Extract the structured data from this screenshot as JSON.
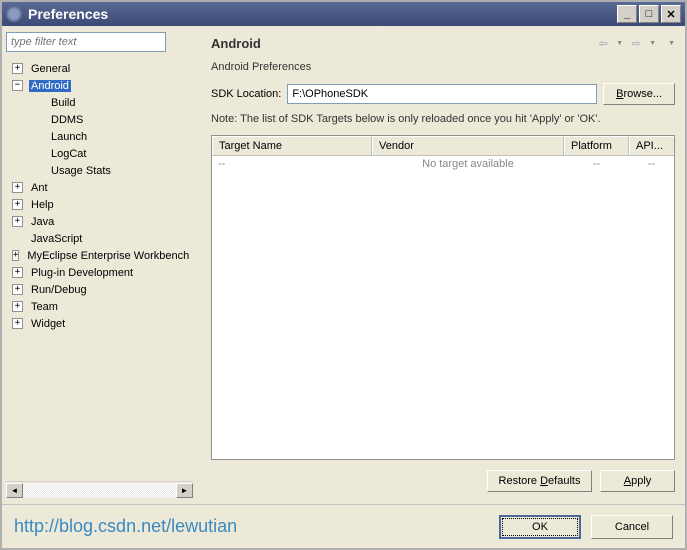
{
  "titlebar": {
    "title": "Preferences"
  },
  "filter": {
    "placeholder": "type filter text"
  },
  "tree": {
    "items": [
      {
        "label": "General",
        "expandable": true,
        "expanded": false,
        "indent": 0,
        "selected": false
      },
      {
        "label": "Android",
        "expandable": true,
        "expanded": true,
        "indent": 0,
        "selected": true
      },
      {
        "label": "Build",
        "expandable": false,
        "indent": 1,
        "selected": false
      },
      {
        "label": "DDMS",
        "expandable": false,
        "indent": 1,
        "selected": false
      },
      {
        "label": "Launch",
        "expandable": false,
        "indent": 1,
        "selected": false
      },
      {
        "label": "LogCat",
        "expandable": false,
        "indent": 1,
        "selected": false
      },
      {
        "label": "Usage Stats",
        "expandable": false,
        "indent": 1,
        "selected": false
      },
      {
        "label": "Ant",
        "expandable": true,
        "expanded": false,
        "indent": 0,
        "selected": false
      },
      {
        "label": "Help",
        "expandable": true,
        "expanded": false,
        "indent": 0,
        "selected": false
      },
      {
        "label": "Java",
        "expandable": true,
        "expanded": false,
        "indent": 0,
        "selected": false
      },
      {
        "label": "JavaScript",
        "expandable": false,
        "indent": 0,
        "selected": false
      },
      {
        "label": "MyEclipse Enterprise Workbench",
        "expandable": true,
        "expanded": false,
        "indent": 0,
        "selected": false
      },
      {
        "label": "Plug-in Development",
        "expandable": true,
        "expanded": false,
        "indent": 0,
        "selected": false
      },
      {
        "label": "Run/Debug",
        "expandable": true,
        "expanded": false,
        "indent": 0,
        "selected": false
      },
      {
        "label": "Team",
        "expandable": true,
        "expanded": false,
        "indent": 0,
        "selected": false
      },
      {
        "label": "Widget",
        "expandable": true,
        "expanded": false,
        "indent": 0,
        "selected": false
      }
    ]
  },
  "page": {
    "title": "Android",
    "section": "Android Preferences",
    "sdk_label": "SDK Location:",
    "sdk_value": "F:\\OPhoneSDK",
    "browse": "Browse...",
    "note": "Note: The list of SDK Targets below is only reloaded once you hit 'Apply' or 'OK'."
  },
  "table": {
    "headers": {
      "target": "Target Name",
      "vendor": "Vendor",
      "platform": "Platform",
      "api": "API..."
    },
    "rows": [
      {
        "target": "--",
        "vendor": "No target available",
        "platform": "--",
        "api": "--"
      }
    ]
  },
  "buttons": {
    "restore": "Restore Defaults",
    "apply": "Apply",
    "ok": "OK",
    "cancel": "Cancel"
  },
  "watermark": "http://blog.csdn.net/lewutian"
}
